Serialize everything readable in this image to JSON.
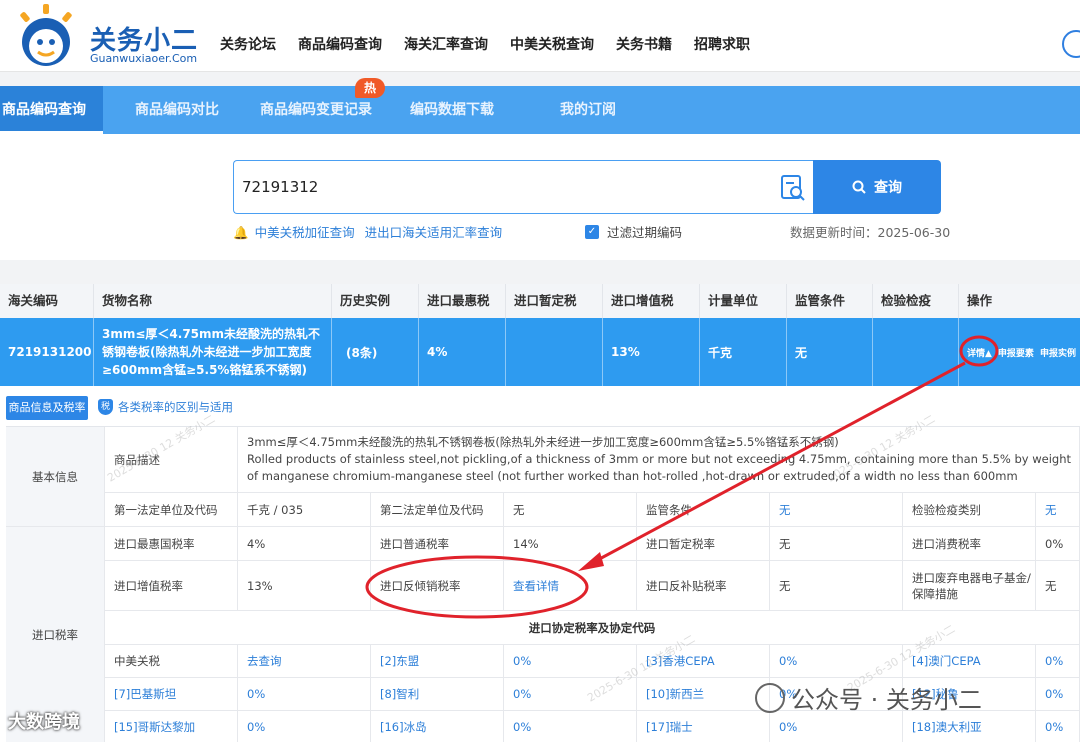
{
  "logo": {
    "name_cn": "关务小二",
    "name_en": "Guanwuxiaoer.Com"
  },
  "top_nav": [
    "关务论坛",
    "商品编码查询",
    "海关汇率查询",
    "中美关税查询",
    "关务书籍",
    "招聘求职"
  ],
  "tabs": [
    "商品编码查询",
    "商品编码对比",
    "商品编码变更记录",
    "编码数据下载",
    "我的订阅"
  ],
  "hot_badge": "热",
  "search": {
    "value": "72191312",
    "button_label": "查询",
    "link_tariff": "中美关税加征查询",
    "link_rate": "进出口海关适用汇率查询",
    "filter_label": "过滤过期编码",
    "update_time": "数据更新时间：2025-06-30"
  },
  "results": {
    "headers": [
      "海关编码",
      "货物名称",
      "历史实例",
      "进口最惠税",
      "进口暂定税",
      "进口增值税",
      "计量单位",
      "监管条件",
      "检验检疫",
      "操作"
    ],
    "row": {
      "code": "7219131200",
      "name": "3mm≤厚＜4.75mm未经酸洗的热轧不锈钢卷板(除热轧外未经进一步加工宽度≥600mm含锰≥5.5%铬锰系不锈钢)",
      "history": "(8条)",
      "mfn": "4%",
      "provisional": "",
      "vat": "13%",
      "unit": "千克",
      "supervision": "无",
      "inspection": "",
      "op_detail": "详情▲",
      "op_elements": "申报要素",
      "op_examples": "申报实例"
    }
  },
  "details": {
    "tab_label": "商品信息及税率",
    "rate_link": "各类税率的区别与适用",
    "basic_info": "基本信息",
    "desc_label": "商品描述",
    "desc_cn": "3mm≤厚＜4.75mm未经酸洗的热轧不锈钢卷板(除热轧外未经进一步加工宽度≥600mm含锰≥5.5%铬锰系不锈钢)",
    "desc_en": "Rolled products of stainless steel,not pickling,of a thickness of 3mm or more but not exceeding 4.75mm, containing more than 5.5% by weight of manganese chromium-manganese steel (not further worked than hot-rolled ,hot-drawn or extruded,of a width no less than 600mm",
    "unit1_label": "第一法定单位及代码",
    "unit1_value": "千克 / 035",
    "unit2_label": "第二法定单位及代码",
    "unit2_value": "无",
    "supervision_label": "监管条件",
    "supervision_value": "无",
    "inspection_label": "检验检疫类别",
    "inspection_value": "无",
    "import_tax": "进口税率",
    "mfn_label": "进口最惠国税率",
    "mfn_value": "4%",
    "general_label": "进口普通税率",
    "general_value": "14%",
    "provisional_label": "进口暂定税率",
    "provisional_value": "无",
    "consumption_label": "进口消费税率",
    "consumption_value": "0%",
    "vat_label": "进口增值税率",
    "vat_value": "13%",
    "antidumping_label": "进口反倾销税率",
    "antidumping_value": "查看详情",
    "subsidy_label": "进口反补贴税率",
    "subsidy_value": "无",
    "waste_label": "进口废弃电器电子基金/保障措施",
    "waste_value": "无",
    "agreement_title": "进口协定税率及协定代码",
    "agreements": [
      [
        {
          "label": "中美关税",
          "value": "去查询"
        },
        {
          "label": "[2]东盟",
          "value": "0%"
        },
        {
          "label": "[3]香港CEPA",
          "value": "0%"
        },
        {
          "label": "[4]澳门CEPA",
          "value": "0%"
        }
      ],
      [
        {
          "label": "[7]巴基斯坦",
          "value": "0%"
        },
        {
          "label": "[8]智利",
          "value": "0%"
        },
        {
          "label": "[10]新西兰",
          "value": "0%"
        },
        {
          "label": "[12]秘鲁",
          "value": "0%"
        }
      ],
      [
        {
          "label": "[15]哥斯达黎加",
          "value": "0%"
        },
        {
          "label": "[16]冰岛",
          "value": "0%"
        },
        {
          "label": "[17]瑞士",
          "value": "0%"
        },
        {
          "label": "[18]澳大利亚",
          "value": "0%"
        }
      ]
    ]
  },
  "watermarks": {
    "wechat": "公众号 · 关务小二",
    "weibo": "大数跨境",
    "faint": "2025-6-30 12 关务小二"
  }
}
